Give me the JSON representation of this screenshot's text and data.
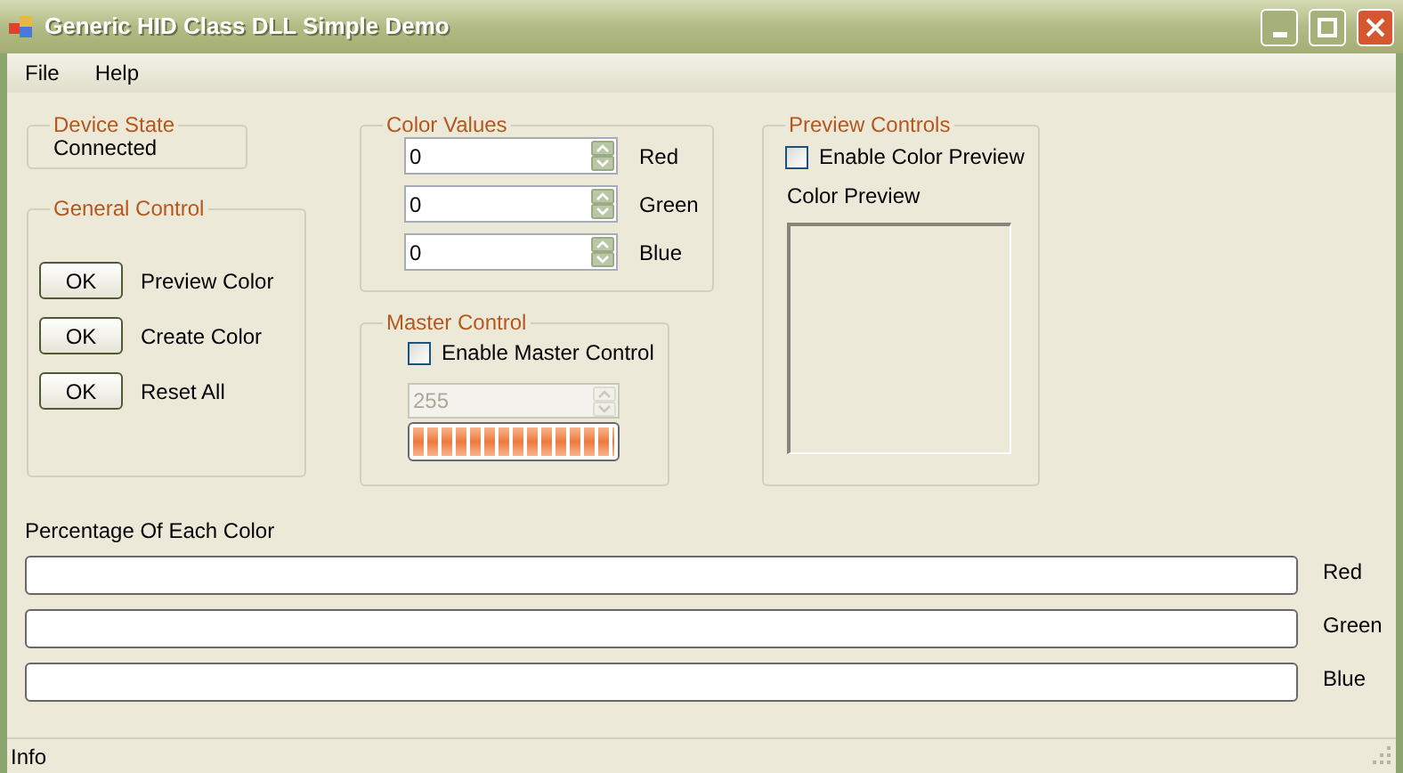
{
  "window": {
    "title": "Generic HID Class DLL Simple Demo"
  },
  "menu": [
    "File",
    "Help"
  ],
  "device_state": {
    "title": "Device State",
    "value": "Connected"
  },
  "general_control": {
    "title": "General Control",
    "actions": [
      {
        "button": "OK",
        "label": "Preview Color"
      },
      {
        "button": "OK",
        "label": "Create Color"
      },
      {
        "button": "OK",
        "label": "Reset All"
      }
    ]
  },
  "color_values": {
    "title": "Color Values",
    "fields": [
      {
        "value": "0",
        "label": "Red"
      },
      {
        "value": "0",
        "label": "Green"
      },
      {
        "value": "0",
        "label": "Blue"
      }
    ]
  },
  "master_control": {
    "title": "Master Control",
    "checkbox": {
      "label": "Enable Master Control",
      "checked": false
    },
    "value": "255",
    "disabled": true,
    "level": 1
  },
  "preview_controls": {
    "title": "Preview Controls",
    "checkbox": {
      "label": "Enable Color Preview",
      "checked": false
    },
    "preview_label": "Color Preview"
  },
  "percentages": {
    "title": "Percentage Of Each Color",
    "bars": [
      {
        "label": "Red",
        "level": 0
      },
      {
        "label": "Green",
        "level": 0
      },
      {
        "label": "Blue",
        "level": 0
      }
    ]
  },
  "status_bar": "Info"
}
